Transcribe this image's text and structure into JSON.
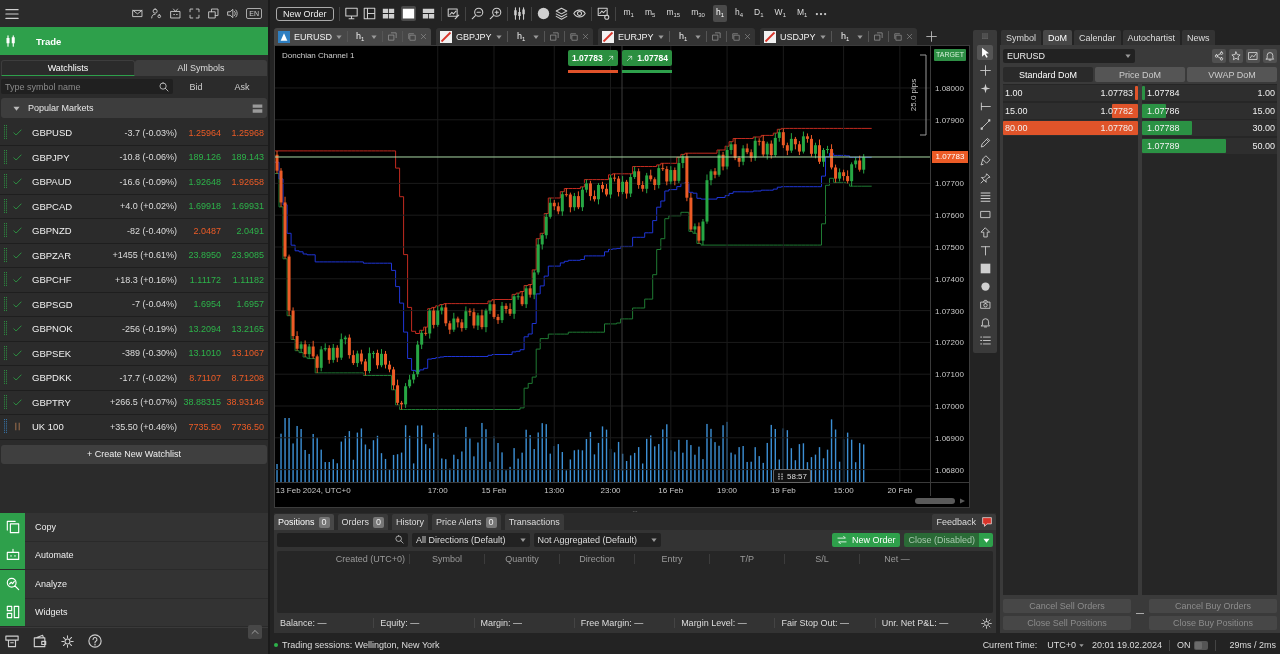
{
  "app_header": {
    "language": "EN"
  },
  "trade_section": {
    "label": "Trade",
    "kind": "trade",
    "selected": true
  },
  "watchlist": {
    "tabs": [
      {
        "label": "Watchlists",
        "selected": true
      },
      {
        "label": "All Symbols",
        "selected": false
      }
    ],
    "search": {
      "placeholder": "Type symbol name"
    },
    "columns": [
      "Bid",
      "Ask"
    ],
    "group": {
      "label": "Popular Markets",
      "expanded": true
    },
    "rows": [
      {
        "symbol": "GBPUSD",
        "open": true,
        "change": "-3.7 (-0.03%)",
        "bid": "1.25964",
        "bid_rising": false,
        "ask": "1.25968",
        "ask_rising": false
      },
      {
        "symbol": "GBPJPY",
        "open": true,
        "change": "-10.8 (-0.06%)",
        "bid": "189.126",
        "bid_rising": true,
        "ask": "189.143",
        "ask_rising": true
      },
      {
        "symbol": "GBPAUD",
        "open": true,
        "change": "-16.6 (-0.09%)",
        "bid": "1.92648",
        "bid_rising": true,
        "ask": "1.92658",
        "ask_rising": false
      },
      {
        "symbol": "GBPCAD",
        "open": true,
        "change": "+4.0 (+0.02%)",
        "bid": "1.69918",
        "bid_rising": true,
        "ask": "1.69931",
        "ask_rising": true
      },
      {
        "symbol": "GBPNZD",
        "open": true,
        "change": "-82 (-0.40%)",
        "bid": "2.0487",
        "bid_rising": false,
        "ask": "2.0491",
        "ask_rising": true
      },
      {
        "symbol": "GBPZAR",
        "open": true,
        "change": "+1455 (+0.61%)",
        "bid": "23.8950",
        "bid_rising": true,
        "ask": "23.9085",
        "ask_rising": true
      },
      {
        "symbol": "GBPCHF",
        "open": true,
        "change": "+18.3 (+0.16%)",
        "bid": "1.11172",
        "bid_rising": true,
        "ask": "1.11182",
        "ask_rising": true
      },
      {
        "symbol": "GBPSGD",
        "open": true,
        "change": "-7 (-0.04%)",
        "bid": "1.6954",
        "bid_rising": true,
        "ask": "1.6957",
        "ask_rising": true
      },
      {
        "symbol": "GBPNOK",
        "open": true,
        "change": "-256 (-0.19%)",
        "bid": "13.2094",
        "bid_rising": true,
        "ask": "13.2165",
        "ask_rising": true
      },
      {
        "symbol": "GBPSEK",
        "open": true,
        "change": "-389 (-0.30%)",
        "bid": "13.1010",
        "bid_rising": true,
        "ask": "13.1067",
        "ask_rising": false
      },
      {
        "symbol": "GBPDKK",
        "open": true,
        "change": "-17.7 (-0.02%)",
        "bid": "8.71107",
        "bid_rising": false,
        "ask": "8.71208",
        "ask_rising": false
      },
      {
        "symbol": "GBPTRY",
        "open": true,
        "change": "+266.5 (+0.07%)",
        "bid": "38.88315",
        "bid_rising": true,
        "ask": "38.93146",
        "ask_rising": false
      },
      {
        "symbol": "UK 100",
        "open": false,
        "change": "+35.50 (+0.46%)",
        "bid": "7735.50",
        "bid_rising": false,
        "ask": "7736.50",
        "ask_rising": false
      }
    ],
    "create_button": "+ Create New Watchlist"
  },
  "sections": [
    {
      "label": "Copy",
      "kind": "copy",
      "selected": false
    },
    {
      "label": "Automate",
      "kind": "automate",
      "selected": false
    },
    {
      "label": "Analyze",
      "kind": "analyze",
      "selected": false
    },
    {
      "label": "Widgets",
      "kind": "widgets",
      "selected": false
    }
  ],
  "toolbar": {
    "new_order": "New Order",
    "layouts": [
      {
        "kind": "grid",
        "selected": false
      },
      {
        "kind": "single",
        "selected": true
      },
      {
        "kind": "split",
        "selected": false
      }
    ],
    "timeframes": [
      {
        "label": "m$_{1}$",
        "selected": false
      },
      {
        "label": "m$_{5}$",
        "selected": false
      },
      {
        "label": "m$_{15}$",
        "selected": false
      },
      {
        "label": "m$_{30}$",
        "selected": false
      },
      {
        "label": "h$_{1}$",
        "selected": true
      },
      {
        "label": "h$_{4}$",
        "selected": false
      },
      {
        "label": "D$_{1}$",
        "selected": false
      },
      {
        "label": "W$_{1}$",
        "selected": false
      },
      {
        "label": "M$_{1}$",
        "selected": false
      }
    ]
  },
  "chart_tabs": [
    {
      "symbol": "EURUSD",
      "kind": "custom",
      "timeframe": "h$_{1}$",
      "selected": true
    },
    {
      "symbol": "GBPJPY",
      "kind": "default",
      "timeframe": "h$_{1}$",
      "selected": false
    },
    {
      "symbol": "EURJPY",
      "kind": "default",
      "timeframe": "h$_{1}$",
      "selected": false
    },
    {
      "symbol": "USDJPY",
      "kind": "default",
      "timeframe": "h$_{1}$",
      "selected": false
    }
  ],
  "chart": {
    "indicator": "Donchian Channel 1",
    "sell_price": "1.07783",
    "buy_price": "1.07784",
    "range_label": "25.0 pips",
    "target_label": "TARGET",
    "current_price": "1.07783",
    "countdown": "58:57",
    "chart_data": {
      "type": "candlestick",
      "grid": true,
      "ylim": [
        1.06761,
        1.08132
      ],
      "yticks": [
        {
          "value": 1.08,
          "label": "1.08000"
        },
        {
          "value": 1.079,
          "label": "1.07900"
        },
        {
          "value": 1.077,
          "label": "1.07700"
        },
        {
          "value": 1.076,
          "label": "1.07600"
        },
        {
          "value": 1.075,
          "label": "1.07500"
        },
        {
          "value": 1.074,
          "label": "1.07400"
        },
        {
          "value": 1.073,
          "label": "1.07300"
        },
        {
          "value": 1.072,
          "label": "1.07200"
        },
        {
          "value": 1.071,
          "label": "1.07100"
        },
        {
          "value": 1.07,
          "label": "1.07000"
        },
        {
          "value": 1.069,
          "label": "1.06900"
        },
        {
          "value": 1.068,
          "label": "1.06800"
        }
      ],
      "ref_lines": [
        {
          "axis": "y",
          "value": 1.07783,
          "color": "#a9d9a5"
        }
      ],
      "categories": [
        null,
        null,
        null,
        null,
        null,
        null,
        null,
        null,
        null,
        "13 Feb 2024, UTC+0",
        null,
        null,
        null,
        null,
        null,
        null,
        null,
        null,
        null,
        null,
        null,
        null,
        null,
        null,
        null,
        null,
        null,
        null,
        null,
        null,
        null,
        null,
        null,
        null,
        null,
        null,
        null,
        null,
        null,
        null,
        "17:00",
        null,
        null,
        null,
        null,
        null,
        null,
        null,
        null,
        null,
        null,
        null,
        null,
        null,
        "15 Feb",
        null,
        null,
        null,
        null,
        null,
        null,
        null,
        null,
        null,
        null,
        null,
        null,
        null,
        null,
        "13:00",
        null,
        null,
        null,
        null,
        null,
        null,
        null,
        null,
        null,
        null,
        null,
        null,
        null,
        "23:00",
        null,
        null,
        null,
        null,
        null,
        null,
        null,
        null,
        null,
        null,
        null,
        null,
        null,
        null,
        "16 Feb",
        null,
        null,
        null,
        null,
        null,
        null,
        null,
        null,
        null,
        null,
        null,
        null,
        null,
        "19:00",
        null,
        null,
        null,
        null,
        null,
        null,
        null,
        null,
        null,
        null,
        null,
        null,
        null,
        "19 Feb",
        null,
        null,
        null,
        null,
        null,
        null,
        null,
        null,
        null,
        null,
        null,
        null,
        null,
        null,
        "15:00",
        null,
        null,
        null,
        null,
        null,
        null,
        null,
        null,
        null,
        null,
        null,
        null,
        null,
        "20 Feb",
        null,
        null,
        null,
        null,
        null,
        null,
        null
      ],
      "ohlc": [
        [
          1.0779,
          1.07802,
          1.07731,
          1.0774
        ],
        [
          1.0774,
          1.07748,
          1.07626,
          1.0764
        ],
        [
          1.0764,
          1.07658,
          1.07463,
          1.0747
        ],
        [
          1.0747,
          1.07476,
          1.07284,
          1.073
        ],
        [
          1.073,
          1.0731,
          1.07209,
          1.0722
        ],
        [
          1.0722,
          1.07235,
          1.07174,
          1.0718
        ],
        [
          1.0718,
          1.07203,
          1.07168,
          1.07194
        ],
        [
          1.07194,
          1.07206,
          1.07154,
          1.07163
        ],
        [
          1.07163,
          1.07195,
          1.07149,
          1.07187
        ],
        [
          1.07187,
          1.07205,
          1.07149,
          1.07156
        ],
        [
          1.07156,
          1.07162,
          1.07104,
          1.0712
        ],
        [
          1.0712,
          1.07188,
          1.07109,
          1.07178
        ],
        [
          1.07178,
          1.07197,
          1.07172,
          1.07182
        ],
        [
          1.07182,
          1.07191,
          1.07133,
          1.07145
        ],
        [
          1.07145,
          1.07195,
          1.07136,
          1.07183
        ],
        [
          1.07183,
          1.07191,
          1.07138,
          1.07152
        ],
        [
          1.07152,
          1.07228,
          1.07145,
          1.0721
        ],
        [
          1.0721,
          1.07221,
          1.07194,
          1.07215
        ],
        [
          1.07215,
          1.07225,
          1.07149,
          1.0716
        ],
        [
          1.0716,
          1.07175,
          1.07129,
          1.07135
        ],
        [
          1.07135,
          1.07174,
          1.07123,
          1.07165
        ],
        [
          1.07165,
          1.07177,
          1.07131,
          1.0714
        ],
        [
          1.0714,
          1.07148,
          1.07096,
          1.0711
        ],
        [
          1.0711,
          1.07184,
          1.07103,
          1.07166
        ],
        [
          1.07166,
          1.07173,
          1.0715,
          1.07167
        ],
        [
          1.07167,
          1.07177,
          1.07117,
          1.07128
        ],
        [
          1.07128,
          1.07179,
          1.07122,
          1.07164
        ],
        [
          1.07164,
          1.07173,
          1.07118,
          1.0713
        ],
        [
          1.0713,
          1.07142,
          1.07106,
          1.07115
        ],
        [
          1.07115,
          1.07123,
          1.07051,
          1.07065
        ],
        [
          1.07065,
          1.07083,
          1.07003,
          1.0701
        ],
        [
          1.0701,
          1.07016,
          1.06989,
          1.07005
        ],
        [
          1.07005,
          1.07072,
          1.06994,
          1.07062
        ],
        [
          1.07062,
          1.07098,
          1.07056,
          1.07083
        ],
        [
          1.07083,
          1.07109,
          1.07071,
          1.071
        ],
        [
          1.071,
          1.07205,
          1.07091,
          1.07193
        ],
        [
          1.07193,
          1.07238,
          1.07179,
          1.0723
        ],
        [
          1.0723,
          1.07248,
          1.07221,
          1.07228
        ],
        [
          1.07228,
          1.07306,
          1.07212,
          1.073
        ],
        [
          1.073,
          1.0731,
          1.07244,
          1.07255
        ],
        [
          1.07255,
          1.07315,
          1.07249,
          1.073
        ],
        [
          1.073,
          1.07319,
          1.07288,
          1.0731
        ],
        [
          1.0731,
          1.07322,
          1.07251,
          1.0726
        ],
        [
          1.0726,
          1.07268,
          1.07226,
          1.0724
        ],
        [
          1.0724,
          1.07293,
          1.07233,
          1.07275
        ],
        [
          1.07275,
          1.07281,
          1.07247,
          1.07263
        ],
        [
          1.07263,
          1.07273,
          1.07234,
          1.07245
        ],
        [
          1.07245,
          1.07313,
          1.07239,
          1.07298
        ],
        [
          1.07298,
          1.07307,
          1.07283,
          1.07295
        ],
        [
          1.07295,
          1.07307,
          1.07244,
          1.07253
        ],
        [
          1.07253,
          1.07293,
          1.07239,
          1.07285
        ],
        [
          1.07285,
          1.07303,
          1.07241,
          1.07248
        ],
        [
          1.07248,
          1.07306,
          1.07232,
          1.073
        ],
        [
          1.073,
          1.0733,
          1.07289,
          1.0732
        ],
        [
          1.0732,
          1.07335,
          1.07274,
          1.0728
        ],
        [
          1.0728,
          1.07289,
          1.07258,
          1.0727
        ],
        [
          1.0727,
          1.07327,
          1.07261,
          1.07315
        ],
        [
          1.07315,
          1.07323,
          1.07291,
          1.07305
        ],
        [
          1.07305,
          1.07323,
          1.07283,
          1.0729
        ],
        [
          1.0729,
          1.07351,
          1.07274,
          1.07345
        ],
        [
          1.07345,
          1.07355,
          1.07334,
          1.07345
        ],
        [
          1.07345,
          1.0736,
          1.07314,
          1.0732
        ],
        [
          1.0732,
          1.07379,
          1.07308,
          1.0737
        ],
        [
          1.0737,
          1.07382,
          1.07341,
          1.0735
        ],
        [
          1.0735,
          1.07428,
          1.07336,
          1.0742
        ],
        [
          1.0742,
          1.07526,
          1.07413,
          1.07508
        ],
        [
          1.07508,
          1.07543,
          1.07492,
          1.07537
        ],
        [
          1.07537,
          1.07605,
          1.07526,
          1.07595
        ],
        [
          1.07595,
          1.07654,
          1.07589,
          1.07639
        ],
        [
          1.07639,
          1.07648,
          1.07616,
          1.07628
        ],
        [
          1.07628,
          1.0764,
          1.07603,
          1.07612
        ],
        [
          1.07612,
          1.07674,
          1.07598,
          1.07666
        ],
        [
          1.07666,
          1.07684,
          1.07658,
          1.07665
        ],
        [
          1.07665,
          1.07671,
          1.07609,
          1.07625
        ],
        [
          1.07625,
          1.0767,
          1.07614,
          1.0766
        ],
        [
          1.0766,
          1.07675,
          1.07619,
          1.07625
        ],
        [
          1.07625,
          1.07689,
          1.07613,
          1.0768
        ],
        [
          1.0768,
          1.07712,
          1.07671,
          1.077
        ],
        [
          1.077,
          1.07708,
          1.07646,
          1.0766
        ],
        [
          1.0766,
          1.07678,
          1.07643,
          1.0765
        ],
        [
          1.0765,
          1.07701,
          1.07634,
          1.07695
        ],
        [
          1.07695,
          1.07705,
          1.07672,
          1.07683
        ],
        [
          1.07683,
          1.07698,
          1.07659,
          1.07665
        ],
        [
          1.07665,
          1.07727,
          1.07653,
          1.07718
        ],
        [
          1.07718,
          1.0773,
          1.07706,
          1.07715
        ],
        [
          1.07715,
          1.07723,
          1.07659,
          1.07673
        ],
        [
          1.07673,
          1.07723,
          1.07666,
          1.07705
        ],
        [
          1.07705,
          1.07711,
          1.07652,
          1.07668
        ],
        [
          1.07668,
          1.0773,
          1.07657,
          1.0772
        ],
        [
          1.0772,
          1.07753,
          1.07714,
          1.07738
        ],
        [
          1.07738,
          1.07747,
          1.07683,
          1.07695
        ],
        [
          1.07695,
          1.07707,
          1.07674,
          1.07683
        ],
        [
          1.07683,
          1.07733,
          1.07669,
          1.07725
        ],
        [
          1.07725,
          1.07743,
          1.07706,
          1.07713
        ],
        [
          1.07713,
          1.07719,
          1.07679,
          1.07695
        ],
        [
          1.07695,
          1.07758,
          1.07684,
          1.07748
        ],
        [
          1.07748,
          1.07763,
          1.07739,
          1.07745
        ],
        [
          1.07745,
          1.07754,
          1.07694,
          1.07706
        ],
        [
          1.07706,
          1.07754,
          1.07697,
          1.07742
        ],
        [
          1.07742,
          1.0775,
          1.07694,
          1.07708
        ],
        [
          1.07708,
          1.07782,
          1.07701,
          1.07764
        ],
        [
          1.07764,
          1.07791,
          1.07748,
          1.07785
        ],
        [
          1.07785,
          1.07795,
          1.07644,
          1.07655
        ],
        [
          1.07655,
          1.0767,
          1.07549,
          1.07555
        ],
        [
          1.07555,
          1.07574,
          1.07543,
          1.07565
        ],
        [
          1.07565,
          1.07577,
          1.07511,
          1.0752
        ],
        [
          1.0752,
          1.07588,
          1.07506,
          1.0758
        ],
        [
          1.0758,
          1.07728,
          1.07573,
          1.0771
        ],
        [
          1.0771,
          1.07744,
          1.07694,
          1.07738
        ],
        [
          1.07738,
          1.07748,
          1.07716,
          1.07727
        ],
        [
          1.07727,
          1.07805,
          1.07721,
          1.0779
        ],
        [
          1.0779,
          1.07799,
          1.07741,
          1.07753
        ],
        [
          1.07753,
          1.07817,
          1.07744,
          1.07805
        ],
        [
          1.07805,
          1.07831,
          1.07791,
          1.07823
        ],
        [
          1.07823,
          1.07841,
          1.07773,
          1.0778
        ],
        [
          1.0778,
          1.07786,
          1.07752,
          1.07768
        ],
        [
          1.07768,
          1.0782,
          1.07757,
          1.0781
        ],
        [
          1.0781,
          1.07825,
          1.07792,
          1.07798
        ],
        [
          1.07798,
          1.07807,
          1.07768,
          1.0778
        ],
        [
          1.0778,
          1.07846,
          1.07771,
          1.07834
        ],
        [
          1.07834,
          1.07842,
          1.07819,
          1.07833
        ],
        [
          1.07833,
          1.07851,
          1.07784,
          1.07791
        ],
        [
          1.07791,
          1.07831,
          1.07775,
          1.07825
        ],
        [
          1.07825,
          1.07835,
          1.07778,
          1.07789
        ],
        [
          1.07789,
          1.07858,
          1.07783,
          1.07843
        ],
        [
          1.07843,
          1.0787,
          1.07831,
          1.07861
        ],
        [
          1.07861,
          1.07873,
          1.07811,
          1.0782
        ],
        [
          1.0782,
          1.07828,
          1.07789,
          1.07803
        ],
        [
          1.07803,
          1.07858,
          1.07796,
          1.0784
        ],
        [
          1.0784,
          1.07846,
          1.07807,
          1.07823
        ],
        [
          1.07823,
          1.07833,
          1.07789,
          1.078
        ],
        [
          1.078,
          1.07863,
          1.07794,
          1.07848
        ],
        [
          1.07848,
          1.07857,
          1.07828,
          1.0784
        ],
        [
          1.0784,
          1.07852,
          1.07784,
          1.07793
        ],
        [
          1.07793,
          1.07828,
          1.07779,
          1.0782
        ],
        [
          1.0782,
          1.07838,
          1.07761,
          1.07768
        ],
        [
          1.07768,
          1.07811,
          1.07752,
          1.07805
        ],
        [
          1.07805,
          1.07818,
          1.07794,
          1.07808
        ],
        [
          1.07808,
          1.07823,
          1.07744,
          1.0775
        ],
        [
          1.0775,
          1.07759,
          1.07703,
          1.07715
        ],
        [
          1.07715,
          1.07747,
          1.07706,
          1.07735
        ],
        [
          1.07735,
          1.07743,
          1.07709,
          1.07723
        ],
        [
          1.07723,
          1.07741,
          1.077,
          1.07707
        ],
        [
          1.07707,
          1.07766,
          1.07691,
          1.0776
        ],
        [
          1.0776,
          1.07782,
          1.07749,
          1.07772
        ],
        [
          1.07772,
          1.07787,
          1.07737,
          1.07743
        ],
        [
          1.07743,
          1.07792,
          1.07731,
          1.07783
        ],
        null,
        null,
        null,
        null,
        null,
        null,
        null,
        null,
        null,
        null,
        null,
        null,
        null,
        null,
        null,
        null
      ]
    }
  },
  "drawing_tools": [
    {
      "kind": "cursor",
      "selected": true
    },
    {
      "kind": "crosshair",
      "selected": false
    },
    {
      "kind": "sparkle",
      "selected": false
    },
    {
      "kind": "ray",
      "selected": false
    },
    {
      "kind": "trend",
      "selected": false
    },
    {
      "kind": "pencil",
      "selected": false
    },
    {
      "kind": "brush",
      "selected": false
    },
    {
      "kind": "pin",
      "selected": false
    },
    {
      "kind": "levels",
      "selected": false
    },
    {
      "kind": "rectangle",
      "selected": false
    },
    {
      "kind": "arrow",
      "selected": false
    },
    {
      "kind": "text",
      "selected": false
    },
    {
      "kind": "swatch",
      "selected": false
    },
    {
      "kind": "circle",
      "selected": false
    },
    {
      "kind": "camera",
      "selected": false
    },
    {
      "kind": "alert",
      "selected": false
    },
    {
      "kind": "list",
      "selected": false
    }
  ],
  "positions_panel": {
    "tabs": [
      {
        "label": "Positions",
        "count": "0",
        "selected": true
      },
      {
        "label": "Orders",
        "count": "0",
        "selected": false
      },
      {
        "label": "History",
        "selected": false
      },
      {
        "label": "Price Alerts",
        "count": "0",
        "selected": false
      },
      {
        "label": "Transactions",
        "selected": false
      }
    ],
    "feedback": "Feedback",
    "filters": [
      "All Directions (Default)",
      "Not Aggregated (Default)"
    ],
    "new_order": "New Order",
    "close_button": {
      "label": "Close (Disabled)",
      "disabled": true
    },
    "columns": [
      "Created (UTC+0)",
      "Symbol",
      "Quantity",
      "Direction",
      "Entry",
      "T/P",
      "S/L",
      "Net —"
    ],
    "summary": [
      {
        "label": "Balance:",
        "value": "—"
      },
      {
        "label": "Equity:",
        "value": "—"
      },
      {
        "label": "Margin:",
        "value": "—"
      },
      {
        "label": "Free Margin:",
        "value": "—"
      },
      {
        "label": "Margin Level:",
        "value": "—"
      },
      {
        "label": "Fair Stop Out:",
        "value": "—"
      },
      {
        "label": "Unr. Net P&L:",
        "value": "—"
      }
    ]
  },
  "side_panel": {
    "tabs": [
      {
        "label": "Symbol",
        "selected": false
      },
      {
        "label": "DoM",
        "selected": true
      },
      {
        "label": "Calendar",
        "selected": false
      },
      {
        "label": "Autochartist",
        "selected": false
      },
      {
        "label": "News",
        "selected": false
      }
    ],
    "symbol": "EURUSD",
    "dom_tabs": [
      {
        "label": "Standard DoM",
        "selected": true
      },
      {
        "label": "Price DoM",
        "selected": false
      },
      {
        "label": "VWAP DoM",
        "selected": false
      }
    ],
    "sell": [
      {
        "volume": "1.00",
        "price": "1.07783",
        "level": 0.02
      },
      {
        "volume": "15.00",
        "price": "1.07782",
        "level": 0.19
      },
      {
        "volume": "80.00",
        "price": "1.07780",
        "level": 1.0
      }
    ],
    "buy": [
      {
        "price": "1.07784",
        "volume": "1.00",
        "level": 0.02
      },
      {
        "price": "1.07786",
        "volume": "15.00",
        "level": 0.18
      },
      {
        "price": "1.07788",
        "volume": "30.00",
        "level": 0.37
      },
      {
        "price": "1.07789",
        "volume": "50.00",
        "level": 0.62
      }
    ],
    "buttons": [
      {
        "label": "Cancel Sell Orders",
        "disabled": true
      },
      {
        "label": "Cancel Buy Orders",
        "disabled": true
      },
      {
        "label": "Close Sell Positions",
        "disabled": true
      },
      {
        "label": "Close Buy Positions",
        "disabled": true
      }
    ]
  },
  "status_bar": {
    "sessions": "Trading sessions: Wellington, New York",
    "time_label": "Current Time:",
    "timezone": "UTC+0",
    "clock": "20:01 19.02.2024",
    "toggle_label": "ON",
    "toggle_on": false,
    "latency": "29ms / 2ms"
  }
}
